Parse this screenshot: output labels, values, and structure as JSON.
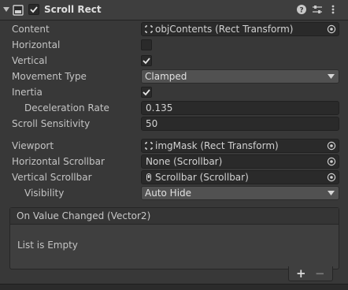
{
  "component": {
    "title": "Scroll Rect",
    "enabled": true
  },
  "fields": {
    "content": {
      "label": "Content",
      "value": "objContents (Rect Transform)"
    },
    "horizontal": {
      "label": "Horizontal",
      "checked": false
    },
    "vertical": {
      "label": "Vertical",
      "checked": true
    },
    "movement_type": {
      "label": "Movement Type",
      "value": "Clamped"
    },
    "inertia": {
      "label": "Inertia",
      "checked": true
    },
    "deceleration_rate": {
      "label": "Deceleration Rate",
      "value": "0.135"
    },
    "scroll_sensitivity": {
      "label": "Scroll Sensitivity",
      "value": "50"
    },
    "viewport": {
      "label": "Viewport",
      "value": "imgMask (Rect Transform)"
    },
    "horizontal_scrollbar": {
      "label": "Horizontal Scrollbar",
      "value": "None (Scrollbar)"
    },
    "vertical_scrollbar": {
      "label": "Vertical Scrollbar",
      "value": "Scrollbar (Scrollbar)"
    },
    "visibility": {
      "label": "Visibility",
      "value": "Auto Hide"
    }
  },
  "event": {
    "title": "On Value Changed (Vector2)",
    "empty_text": "List is Empty",
    "add_label": "+",
    "remove_label": "−"
  },
  "icons": {
    "header": [
      "foldout-arrow-icon",
      "component-icon",
      "help-icon",
      "preset-icon",
      "kebab-menu-icon"
    ],
    "rect_transform": "rect-transform-icon",
    "scrollbar": "scrollbar-icon",
    "object_picker": "object-picker-icon"
  },
  "colors": {
    "background": "#383838",
    "field": "#2a2a2a",
    "dropdown": "#515151",
    "text": "#c4c4c4"
  }
}
